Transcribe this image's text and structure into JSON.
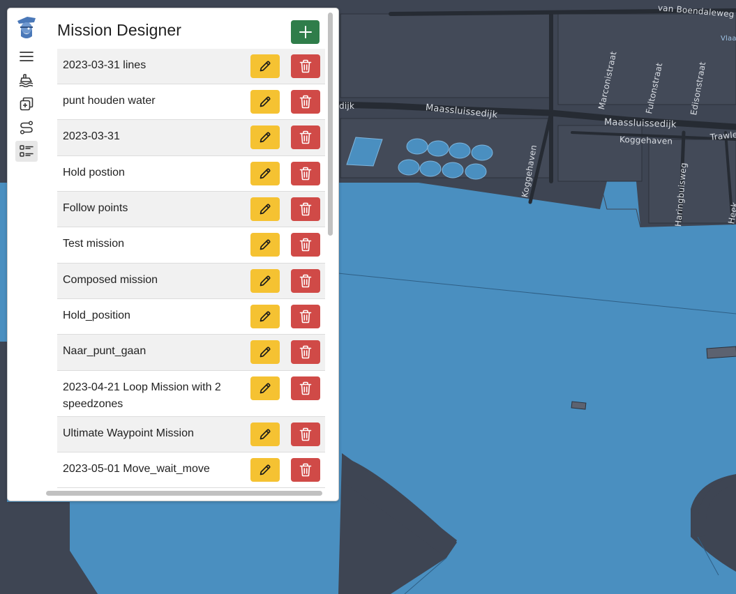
{
  "panel": {
    "title": "Mission Designer",
    "add_icon": "plus-icon",
    "rail": [
      {
        "name": "logo",
        "icon": "captain-logo-icon"
      },
      {
        "name": "menu",
        "icon": "hamburger-menu-icon"
      },
      {
        "name": "vessels",
        "icon": "ship-icon"
      },
      {
        "name": "zones",
        "icon": "layers-icon"
      },
      {
        "name": "routes",
        "icon": "route-icon"
      },
      {
        "name": "missions",
        "icon": "list-icon",
        "active": true
      }
    ],
    "missions": [
      {
        "name": "2023-03-31 lines"
      },
      {
        "name": "punt houden water"
      },
      {
        "name": "2023-03-31"
      },
      {
        "name": "Hold postion"
      },
      {
        "name": "Follow points"
      },
      {
        "name": "Test mission"
      },
      {
        "name": "Composed mission"
      },
      {
        "name": "Hold_position"
      },
      {
        "name": "Naar_punt_gaan"
      },
      {
        "name": "2023-04-21 Loop Mission with 2 speedzones"
      },
      {
        "name": "Ultimate Waypoint Mission"
      },
      {
        "name": "2023-05-01 Move_wait_move"
      }
    ],
    "colors": {
      "add": "#2f7d4a",
      "edit": "#f5c232",
      "delete": "#d04a47",
      "row_alt": "#f1f1f1"
    }
  },
  "map": {
    "colors": {
      "land": "#3e4553",
      "water": "#4a8fc0",
      "road": "#262b33"
    },
    "labels": [
      {
        "text": "van Boendaleweg"
      },
      {
        "text": "Maassluissedijk"
      },
      {
        "text": "Maassluissedijk"
      },
      {
        "text": "Koggehaven"
      },
      {
        "text": "Koggehaven"
      },
      {
        "text": "Marconistraat"
      },
      {
        "text": "Fultonstraat"
      },
      {
        "text": "Edisonstraat"
      },
      {
        "text": "Haringbuisweg"
      },
      {
        "text": "Trawle"
      },
      {
        "text": "Heek"
      },
      {
        "text": "Vlaar"
      },
      {
        "text": "dijk"
      }
    ]
  }
}
